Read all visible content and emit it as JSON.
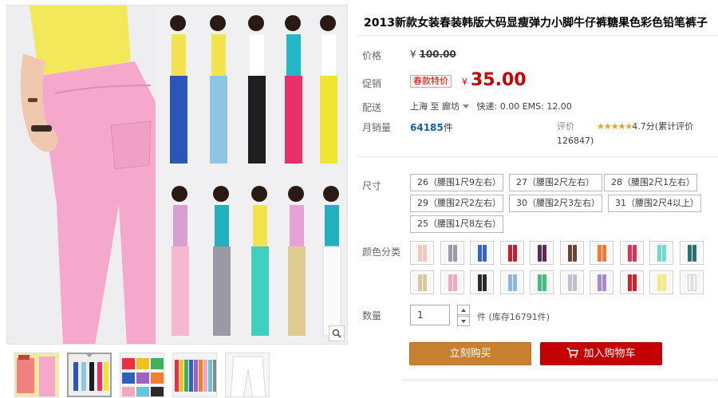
{
  "product": {
    "title": "2013新款女装春装韩版大码显瘦弹力小脚牛仔裤糖果色彩色铅笔裤子"
  },
  "price": {
    "label": "价格",
    "currency": "¥",
    "original": "100.00"
  },
  "promo": {
    "label": "促销",
    "tag": "春款特价",
    "currency": "¥",
    "price": "35.00"
  },
  "shipping": {
    "label": "配送",
    "from": "上海",
    "to_word": "至",
    "destination": "廊坊",
    "fees": "快递: 0.00 EMS: 12.00"
  },
  "sales": {
    "label": "月销量",
    "count": "64185",
    "unit": "件"
  },
  "rating": {
    "label": "评价",
    "stars": "★★★★★",
    "score": "4.7分",
    "count_text": "(累计评价126847)"
  },
  "size": {
    "label": "尺寸",
    "options": [
      "26（腰围1尺9左右）",
      "27（腰围2尺左右）",
      "28（腰围2尺1左右）",
      "29（腰围2尺2左右）",
      "30（腰围2尺3左右）",
      "31（腰围2尺4以上）",
      "25（腰围1尺8左右）"
    ]
  },
  "colors": {
    "label": "颜色分类",
    "swatches": [
      "#f2c7c0",
      "#9a9aa8",
      "#3a63c4",
      "#c02030",
      "#5a2a52",
      "#6a4630",
      "#f07a30",
      "#e0305a",
      "#70d8d0",
      "#2a7070",
      "#d8c8a0",
      "#f4a8c0",
      "#2a2a2a",
      "#8ab8e0",
      "#40c080",
      "#c0c0c8",
      "#a888d0",
      "#d02030",
      "#f4e880",
      "#f4f4f4"
    ]
  },
  "quantity": {
    "label": "数量",
    "value": "1",
    "unit": "件",
    "stock": "(库存16791件)"
  },
  "actions": {
    "buy_now": "立刻购买",
    "add_to_cart": "加入购物车"
  },
  "theme": {
    "accent": "#c40000",
    "buy_color": "#c98030",
    "link": "#1f5d94"
  }
}
